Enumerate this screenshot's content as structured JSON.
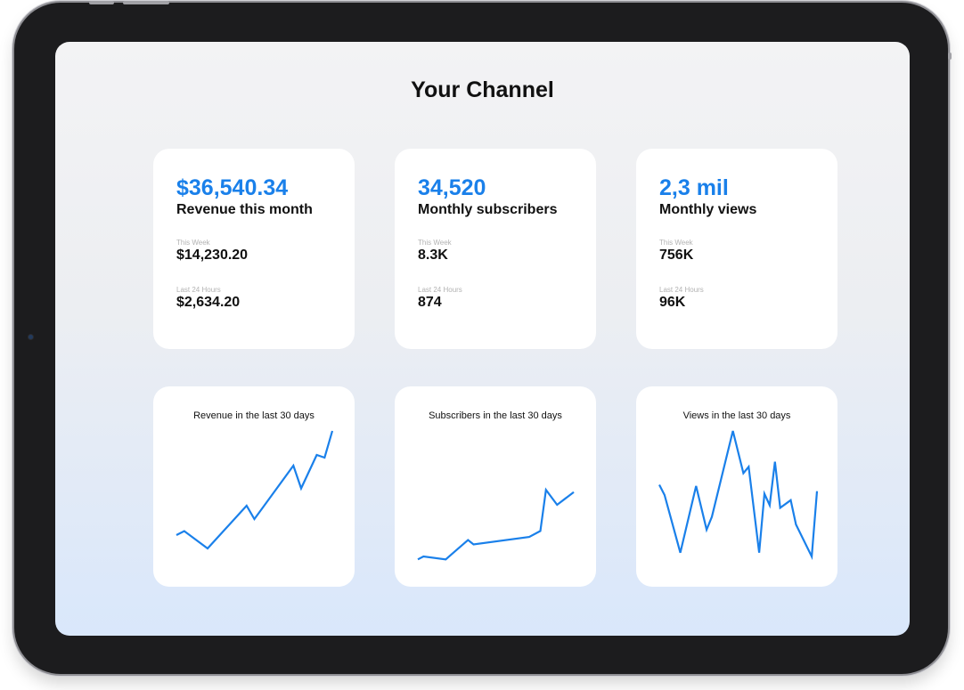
{
  "page": {
    "title": "Your Channel",
    "accent_color": "#1a80ea"
  },
  "stats": [
    {
      "headline": "$36,540.34",
      "label": "Revenue this month",
      "week_label": "This Week",
      "week_value": "$14,230.20",
      "day_label": "Last 24 Hours",
      "day_value": "$2,634.20"
    },
    {
      "headline": "34,520",
      "label": "Monthly subscribers",
      "week_label": "This Week",
      "week_value": "8.3K",
      "day_label": "Last 24 Hours",
      "day_value": "874"
    },
    {
      "headline": "2,3 mil",
      "label": "Monthly views",
      "week_label": "This Week",
      "week_value": "756K",
      "day_label": "Last 24 Hours",
      "day_value": "96K"
    }
  ],
  "chart_data": [
    {
      "type": "line",
      "title": "Revenue in the last 30 days",
      "x": [
        0,
        1,
        4,
        9,
        10,
        11,
        15,
        16,
        18,
        19,
        20
      ],
      "values": [
        20,
        23,
        10,
        42,
        32,
        40,
        72,
        55,
        80,
        78,
        98
      ],
      "ylim": [
        0,
        100
      ],
      "grid": false
    },
    {
      "type": "line",
      "title": "Subscribers in the last 30 days",
      "x": [
        0,
        1,
        5,
        9,
        10,
        20,
        22,
        23,
        25,
        28
      ],
      "values": [
        2,
        6,
        2,
        28,
        22,
        32,
        40,
        95,
        75,
        92
      ],
      "ylim": [
        0,
        100
      ],
      "grid": false
    },
    {
      "type": "line",
      "title": "Views in the last 30 days",
      "x": [
        0,
        1,
        4,
        7,
        9,
        10,
        14,
        16,
        17,
        19,
        20,
        21,
        22,
        23,
        25,
        26,
        29,
        30
      ],
      "values": [
        58,
        50,
        5,
        57,
        23,
        33,
        100,
        67,
        72,
        5,
        51,
        42,
        76,
        40,
        46,
        27,
        2,
        53
      ],
      "ylim": [
        0,
        100
      ],
      "grid": false
    }
  ]
}
